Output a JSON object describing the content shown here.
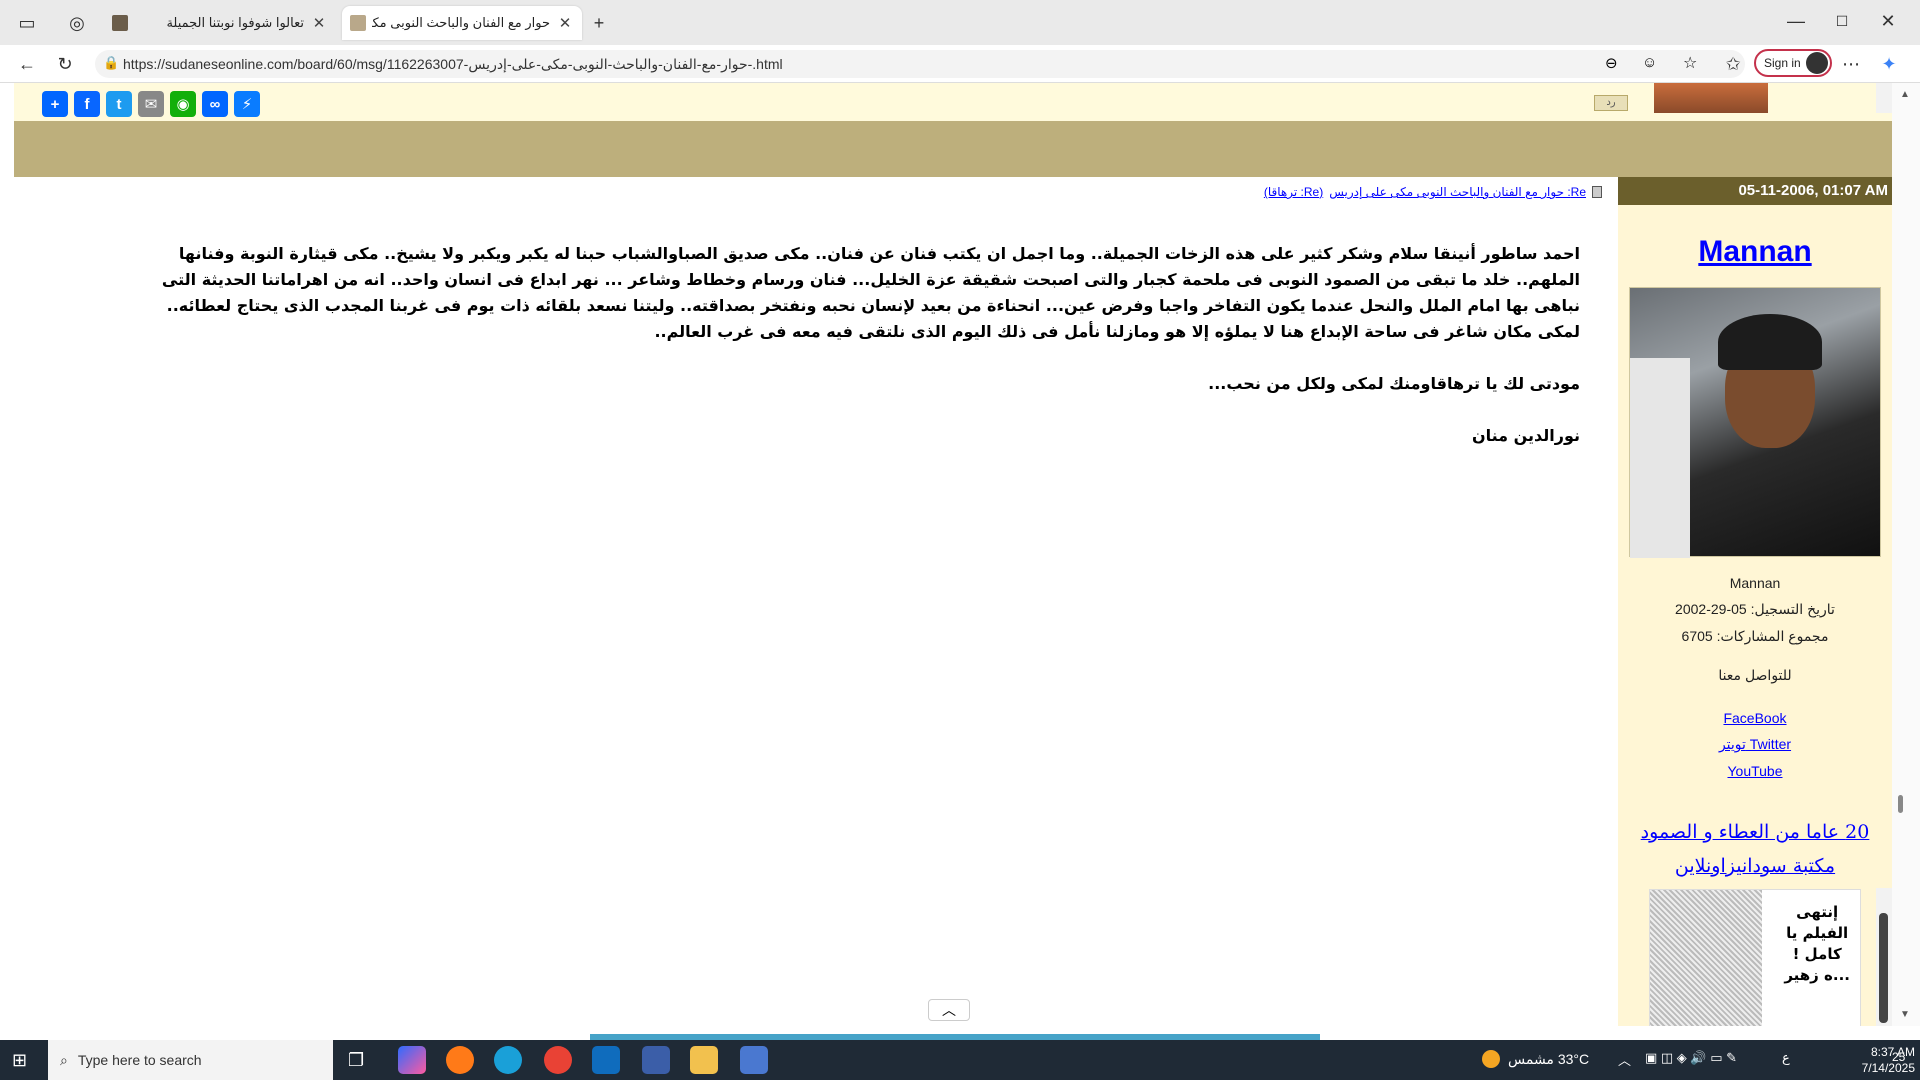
{
  "browser": {
    "tabs": [
      {
        "title": "تعالوا شوفوا نوبتنا الجميلة",
        "active": false
      },
      {
        "title": "حوار مع الفنان والباحث النوبى مكى",
        "active": true
      }
    ],
    "url": "https://sudaneseonline.com/board/60/msg/حوار-مع-الفنان-والباحث-النوبى-مكى-على-إدريس-1162263007-.html",
    "signin_label": "Sign in"
  },
  "page": {
    "reply_label": "رد",
    "message_link": "Re: حوار مع الفنان والباحث النوبى مكى على إدريس",
    "message_link_suffix": "(Re: ترهاقا)",
    "post_date": "05-11-2006, 01:07 AM",
    "post_paragraphs": [
      "احمد ساطور أنينقا سلام وشكر كثير على هذه الزخات الجميلة.. وما اجمل ان يكتب فنان عن فنان.. مكى صديق الصباوالشباب حبنا له يكبر ويكبر ولا يشيخ.. مكى قيثارة النوبة وفنانها الملهم.. خلد ما تبقى من الصمود النوبى فى ملحمة كجبار والتى اصبحت شقيقة عزة الخليل... فنان ورسام وخطاط وشاعر ... نهر ابداع فى انسان واحد.. انه من اهراماتنا الحديثة التى نباهى بها امام الملل والنحل عندما يكون التفاخر واجبا وفرض عين... انحناءة من بعيد لإنسان نحبه ونفتخر بصداقته.. وليتنا نسعد بلقائه ذات يوم فى غربنا المجدب الذى يحتاج لعطائه.. لمكى مكان شاغر فى ساحة الإبداع هنا لا يملؤه إلا هو ومازلنا نأمل فى ذلك اليوم الذى نلتقى فيه معه فى غرب العالم..",
      "مودتى لك يا ترهاقاومنك لمكى ولكل من نحب...",
      "نورالدين منان"
    ]
  },
  "sidebar": {
    "username": "Mannan",
    "username_small": "Mannan",
    "reg_date": "تاريخ التسجيل: 05-29-2002",
    "post_count": "مجموع المشاركات: 6705",
    "contact": "للتواصل معنا",
    "links": [
      "FaceBook",
      "تويتر Twitter",
      "YouTube"
    ],
    "ad_line1": "20 عاما من العطاء و الصمود",
    "ad_line2": "مكتبة سودانيزاونلاين",
    "ad_image_text": [
      "إنتهى",
      "الفيلم يا",
      "كامل !",
      "...ه زهير"
    ]
  },
  "taskbar": {
    "search_placeholder": "Type here to search",
    "weather": "33°C  مشمس",
    "time": "8:37 AM",
    "date": "7/14/2025",
    "notifications": "25"
  },
  "colors": {
    "olive": "#bdaf7c",
    "date_bar": "#6b5f2c",
    "sidebar_bg": "#fff6d5",
    "link": "#0000ff"
  }
}
